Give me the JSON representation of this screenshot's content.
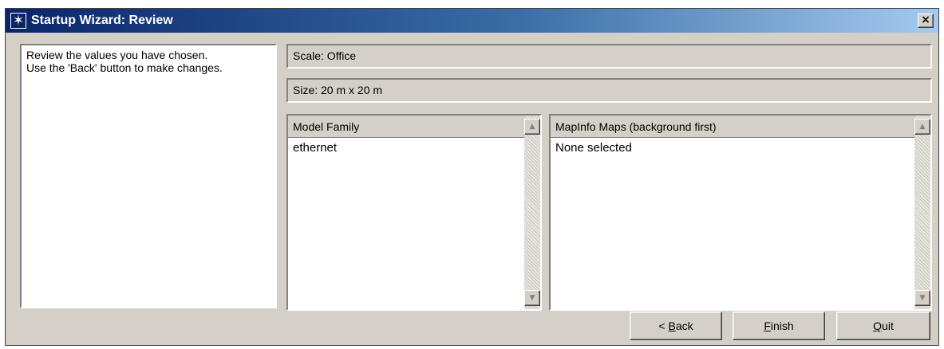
{
  "window": {
    "title": "Startup Wizard: Review",
    "close_label": "×"
  },
  "description": "Review the values you have chosen.\nUse the 'Back' button to make changes.",
  "fields": {
    "scale": "Scale: Office",
    "size": "Size: 20 m x 20 m"
  },
  "lists": {
    "model_family": {
      "header": "Model Family",
      "items": [
        "ethernet"
      ]
    },
    "mapinfo_maps": {
      "header": "MapInfo Maps (background first)",
      "items": [
        "None selected"
      ]
    }
  },
  "buttons": {
    "back": {
      "prefix": "< ",
      "mnemonic": "B",
      "rest": "ack"
    },
    "finish": {
      "prefix": "",
      "mnemonic": "F",
      "rest": "inish"
    },
    "quit": {
      "prefix": "",
      "mnemonic": "Q",
      "rest": "uit"
    }
  },
  "icons": {
    "app": "wizard-star-icon",
    "scroll_up": "arrow-up-icon",
    "scroll_down": "arrow-down-icon"
  },
  "colors": {
    "titlebar_start": "#0a246a",
    "titlebar_end": "#a6caf0",
    "dialog_face": "#d4d0c8"
  }
}
